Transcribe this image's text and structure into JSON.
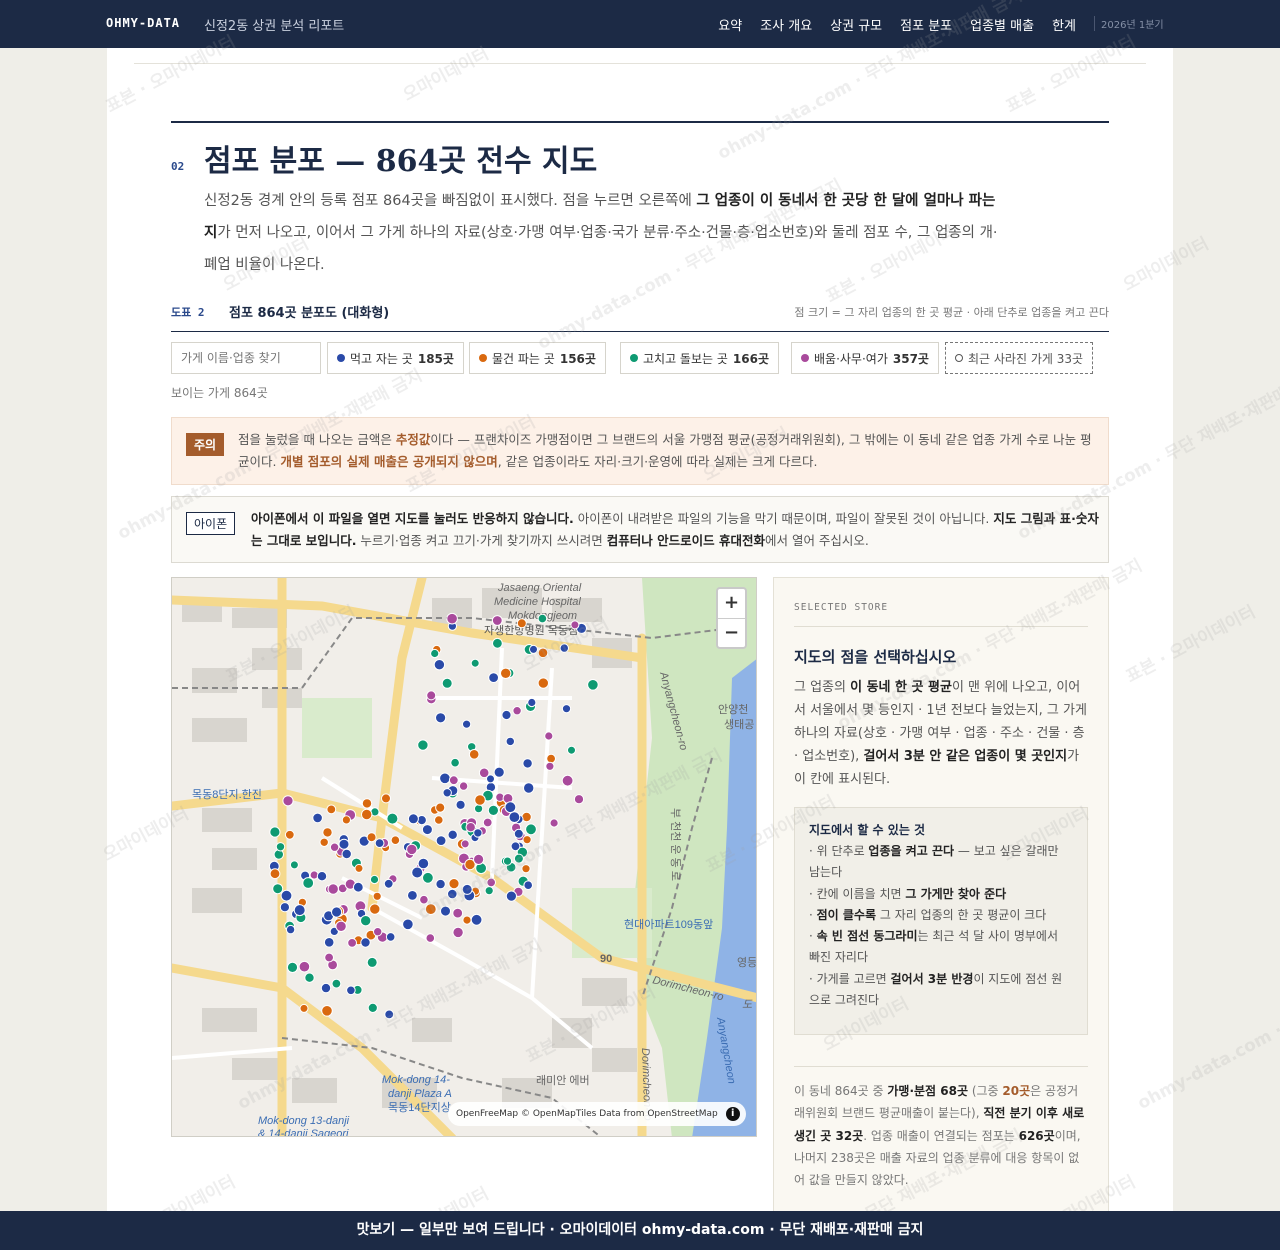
{
  "header": {
    "brand": "OHMY-DATA",
    "report_title": "신정2동 상권 분석 리포트",
    "nav": [
      "요약",
      "조사 개요",
      "상권 규모",
      "점포 분포",
      "업종별 매출",
      "한계"
    ],
    "period": "2026년 1분기"
  },
  "section": {
    "number": "02",
    "title": "점포 분포 — 864곳 전수 지도",
    "lead_1": "신정2동 경계 안의 등록 점포 864곳을 빠짐없이 표시했다. 점을 누르면 오른쪽에 ",
    "lead_bold_1": "그 업종이 이 동네서 한 곳당 한 달에 얼마나 파는지",
    "lead_2": "가 먼저 나오고, 이어서 그 가게 하나의 자료(상호·가맹 여부·업종·국가 분류·주소·건물·층·업소번호)와 둘레 점포 수, 그 업종의 개·폐업 비율이 나온다."
  },
  "figure": {
    "label": "도표 2",
    "title": "점포 864곳 분포도 (대화형)",
    "note": "점 크기 = 그 자리 업종의 한 곳 평균 · 아래 단추로 업종을 켜고 끈다"
  },
  "controls": {
    "search_placeholder": "가게 이름·업종 찾기",
    "chips": [
      {
        "label": "먹고 자는 곳",
        "count": "185곳",
        "color": "#2a4aa8"
      },
      {
        "label": "물건 파는 곳",
        "count": "156곳",
        "color": "#d9690f"
      },
      {
        "label": "고치고 돌보는 곳",
        "count": "166곳",
        "color": "#0e9a72"
      },
      {
        "label": "배움·사무·여가",
        "count": "357곳",
        "color": "#a94a9c"
      }
    ],
    "closed_chip": "최근 사라진 가게 33곳",
    "visible_count": "보이는 가게 864곳"
  },
  "caution": {
    "tag": "주의",
    "t1": "점을 눌렀을 때 나오는 금액은 ",
    "b1": "추정값",
    "t2": "이다 — 프랜차이즈 가맹점이면 그 브랜드의 서울 가맹점 평균(공정거래위원회), 그 밖에는 이 동네 같은 업종 가게 수로 나눈 평균이다. ",
    "b2": "개별 점포의 실제 매출은 공개되지 않으며",
    "t3": ", 같은 업종이라도 자리·크기·운영에 따라 실제는 크게 다르다."
  },
  "iphone": {
    "tag": "아이폰",
    "b1": "아이폰에서 이 파일을 열면 지도를 눌러도 반응하지 않습니다.",
    "t1": " 아이폰이 내려받은 파일의 기능을 막기 때문이며, 파일이 잘못된 것이 아닙니다. ",
    "b2": "지도 그림과 표·숫자는 그대로 보입니다.",
    "t2": " 누르기·업종 켜고 끄기·가게 찾기까지 쓰시려면 ",
    "b3": "컴퓨터나 안드로이드 휴대전화",
    "t3": "에서 열어 주십시오."
  },
  "map": {
    "labels": [
      "Jasaeng Oriental",
      "Medicine Hospital",
      "Mokdongjeom",
      "자생한방병원 목동점",
      "목동8단지.한진",
      "현대아파트109동앞",
      "Dorimcheon-ro",
      "도",
      "Anyangcheon-ro",
      "안양천",
      "생태공",
      "Mok-dong 14-",
      "danji Plaza A",
      "목동14단지상",
      "Mok-dong 13-danji",
      "& 14-danji Sageori",
      "래미안 에버",
      "90",
      "영등",
      "Anyangcheon",
      "부 천천 운 동 로",
      "Dorimcheon-ro"
    ],
    "attribution": "OpenFreeMap © OpenMapTiles Data from OpenStreetMap",
    "zoom_in": "+",
    "zoom_out": "−",
    "info": "i"
  },
  "panel": {
    "kicker": "SELECTED STORE",
    "title": "지도의 점을 선택하십시오",
    "d1": "그 업종의 ",
    "db1": "이 동네 한 곳 평균",
    "d2": "이 맨 위에 나오고, 이어서 서울에서 몇 등인지 · 1년 전보다 늘었는지, 그 가게 하나의 자료(상호 · 가맹 여부 · 업종 · 주소 · 건물 · 층 · 업소번호), ",
    "db2": "걸어서 3분 안 같은 업종이 몇 곳인지",
    "d3": "가 이 칸에 표시된다.",
    "howto_title": "지도에서 할 수 있는 것",
    "howto": [
      {
        "pre": "· 위 단추로 ",
        "b": "업종을 켜고 끈다",
        "post": " — 보고 싶은 갈래만 남는다"
      },
      {
        "pre": "· 칸에 이름을 치면 ",
        "b": "그 가게만 찾아 준다",
        "post": ""
      },
      {
        "pre": "· ",
        "b": "점이 클수록",
        "post": " 그 자리 업종의 한 곳 평균이 크다"
      },
      {
        "pre": "· ",
        "b": "속 빈 점선 동그라미",
        "post": "는 최근 석 달 사이 명부에서 빠진 자리다"
      },
      {
        "pre": "· 가게를 고르면 ",
        "b": "걸어서 3분 반경",
        "post": "이 지도에 점선 원으로 그려진다"
      }
    ],
    "s1": "이 동네 864곳 중 ",
    "sb1": "가맹·분점 68곳",
    "s2": " (그중 ",
    "sb2": "20곳",
    "s3": "은 공정거래위원회 브랜드 평균매출이 붙는다), ",
    "sb3": "직전 분기 이후 새로 생긴 곳 32곳",
    "s4": ". 업종 매출이 연결되는 점포는 ",
    "sb4": "626곳",
    "s5": "이며, 나머지 238곳은 매출 자료의 업종 분류에 대응 항목이 없어 값을 만들지 않았다."
  },
  "watermark": [
    "표본 · 오마이데이터",
    "오마이데이터",
    "ohmy-data.com · 무단 재배포·재판매 금지"
  ],
  "footer": "맛보기 — 일부만 보여 드립니다 · 오마이데이터 ohmy-data.com · 무단 재배포·재판매 금지"
}
